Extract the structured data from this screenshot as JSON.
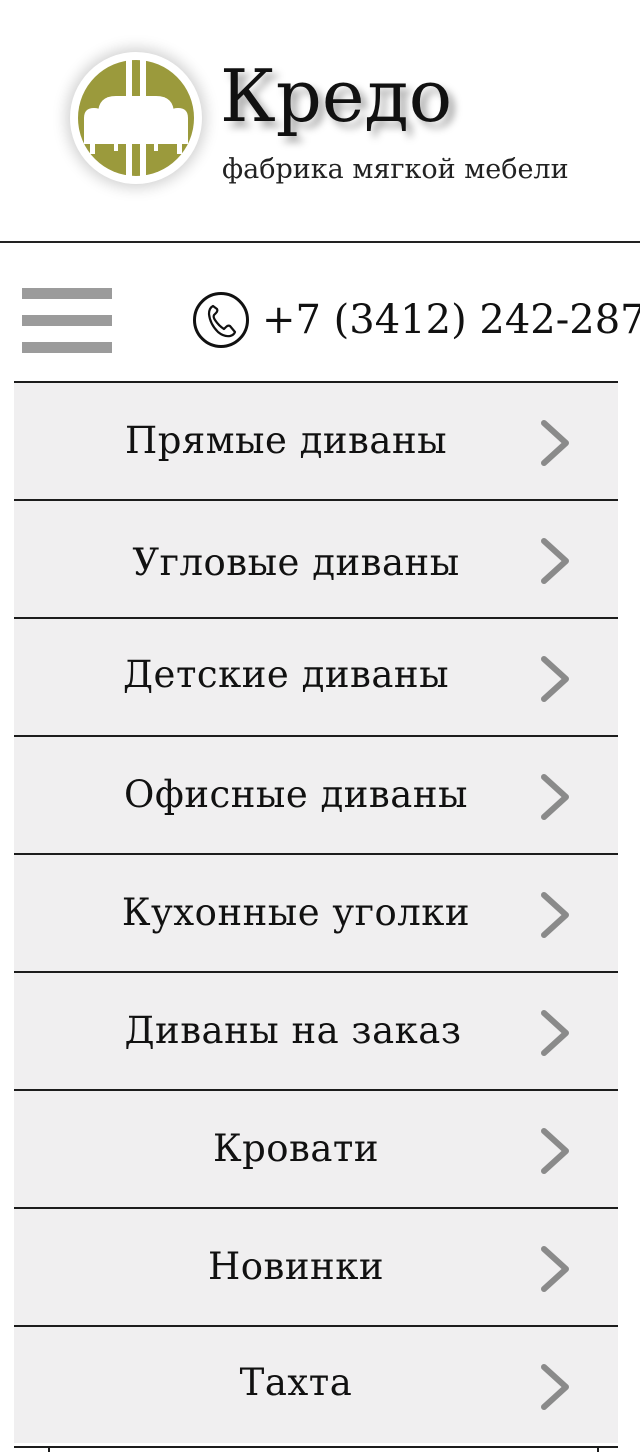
{
  "brand": {
    "title": "Кредо",
    "subtitle": "фабрика мягкой мебели"
  },
  "contact": {
    "phone": "+7 (3412) 242-287"
  },
  "icons": {
    "menu": "hamburger-menu-icon",
    "phone": "phone-icon",
    "chevron": "chevron-right-icon",
    "logo": "sofa-logo"
  },
  "colors": {
    "logo_olive": "#9b9a3c",
    "menu_background": "#f0eff0",
    "chevron": "#8a8a8a",
    "hamburger": "#9b9b9b"
  },
  "menu": {
    "items": [
      {
        "label": "Прямые диваны"
      },
      {
        "label": "Угловые диваны"
      },
      {
        "label": "Детские диваны"
      },
      {
        "label": "Офисные диваны"
      },
      {
        "label": "Кухонные уголки"
      },
      {
        "label": "Диваны на заказ"
      },
      {
        "label": "Кровати"
      },
      {
        "label": "Новинки"
      },
      {
        "label": "Тахта"
      }
    ]
  }
}
